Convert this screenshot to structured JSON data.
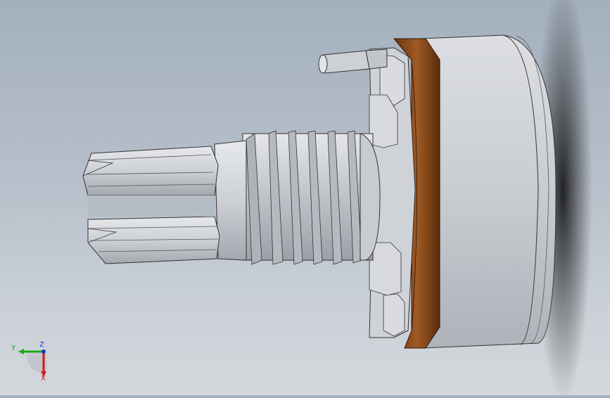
{
  "viewport": {
    "background_top": "#a4b0be",
    "background_bottom": "#d4d8dd",
    "part_colors": {
      "metal": "#c5c8cd",
      "brass_ring": "#8a4a1c",
      "body": "#d3d5d9"
    }
  },
  "triad": {
    "x_label": "X",
    "y_label": "Y",
    "z_label": "Z",
    "x_color": "#d01818",
    "y_color": "#18a818",
    "z_color": "#1838d0"
  }
}
